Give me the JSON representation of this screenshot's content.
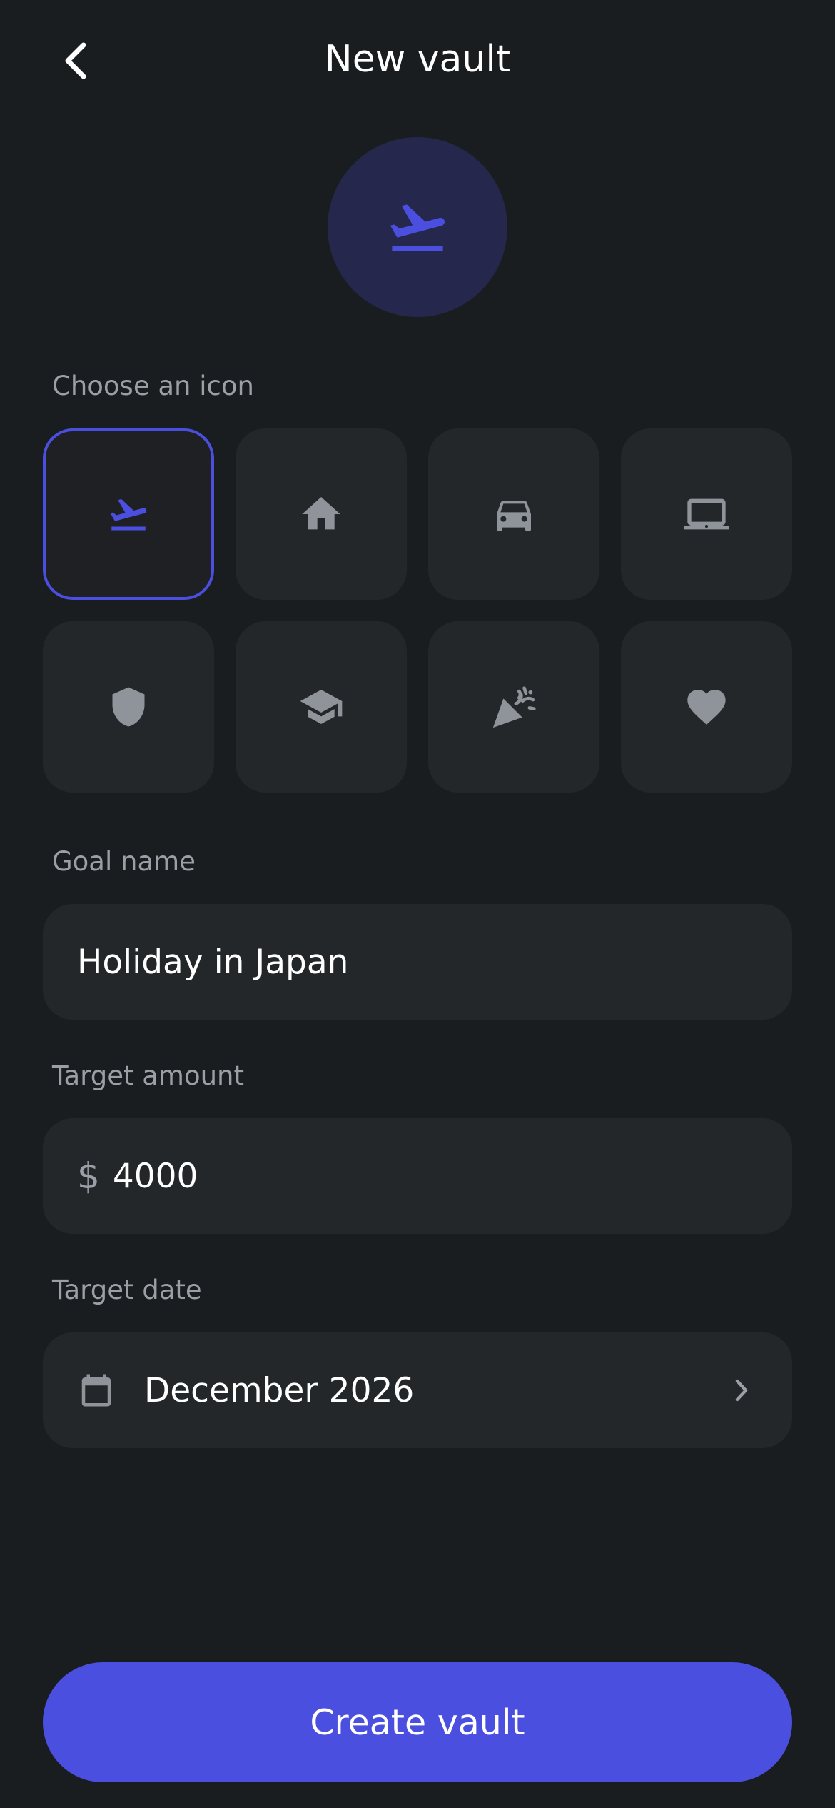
{
  "header": {
    "title": "New vault",
    "back_icon": "chevron-left-icon"
  },
  "hero": {
    "icon": "flight-takeoff-icon",
    "accent": "#4a4fe0",
    "bg": "#25274d"
  },
  "icon_picker": {
    "label": "Choose an icon",
    "selected": "flight-takeoff",
    "options": [
      {
        "icon": "flight-takeoff-icon",
        "selected": true
      },
      {
        "icon": "home-icon",
        "selected": false
      },
      {
        "icon": "car-icon",
        "selected": false
      },
      {
        "icon": "laptop-icon",
        "selected": false
      },
      {
        "icon": "shield-icon",
        "selected": false
      },
      {
        "icon": "graduation-cap-icon",
        "selected": false
      },
      {
        "icon": "party-popper-icon",
        "selected": false
      },
      {
        "icon": "heart-icon",
        "selected": false
      }
    ]
  },
  "goal_name": {
    "label": "Goal name",
    "value": "Holiday in Japan"
  },
  "target_amount": {
    "label": "Target amount",
    "currency": "$",
    "value": "4000"
  },
  "target_date": {
    "label": "Target date",
    "value": "December 2026",
    "icon": "calendar-icon"
  },
  "actions": {
    "create_label": "Create vault"
  },
  "colors": {
    "background": "#1a1d20",
    "surface": "#24272a",
    "accent": "#4a4fe0",
    "muted": "#9aa0a6"
  }
}
